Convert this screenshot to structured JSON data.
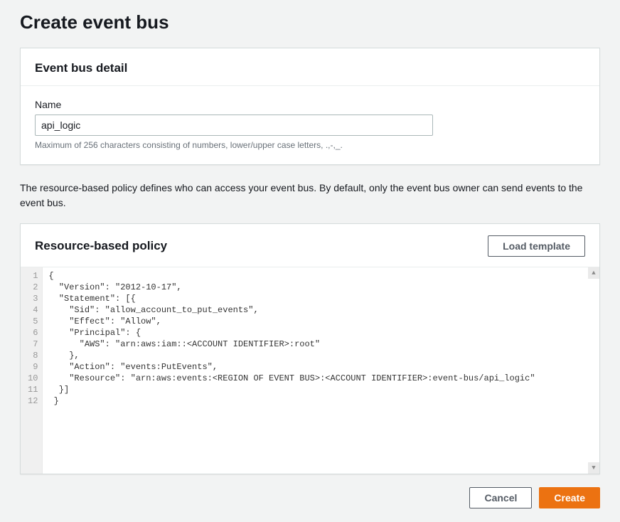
{
  "page": {
    "title": "Create event bus"
  },
  "detail_panel": {
    "title": "Event bus detail",
    "name_label": "Name",
    "name_value": "api_logic",
    "name_hint": "Maximum of 256 characters consisting of numbers, lower/upper case letters, .,-,_."
  },
  "description": "The resource-based policy defines who can access your event bus. By default, only the event bus owner can send events to the event bus.",
  "policy_panel": {
    "title": "Resource-based policy",
    "load_template_label": "Load template",
    "gutter": " 1\n 2\n 3\n 4\n 5\n 6\n 7\n 8\n 9\n10\n11\n12",
    "code": "{\n  \"Version\": \"2012-10-17\",\n  \"Statement\": [{\n    \"Sid\": \"allow_account_to_put_events\",\n    \"Effect\": \"Allow\",\n    \"Principal\": {\n      \"AWS\": \"arn:aws:iam::<ACCOUNT IDENTIFIER>:root\"\n    },\n    \"Action\": \"events:PutEvents\",\n    \"Resource\": \"arn:aws:events:<REGION OF EVENT BUS>:<ACCOUNT IDENTIFIER>:event-bus/api_logic\"\n  }]\n }"
  },
  "footer": {
    "cancel_label": "Cancel",
    "create_label": "Create"
  }
}
